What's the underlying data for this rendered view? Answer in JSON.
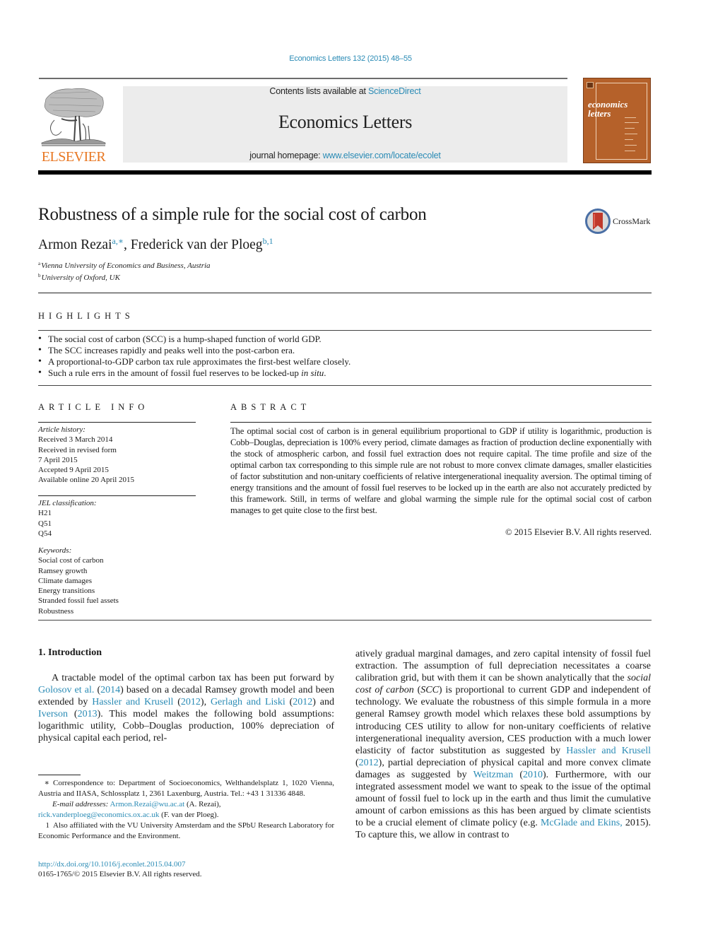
{
  "header": {
    "citation": "Economics Letters 132 (2015) 48–55",
    "contents_prefix": "Contents lists available at ",
    "contents_link": "ScienceDirect",
    "journal_name": "Economics Letters",
    "homepage_prefix": "journal homepage: ",
    "homepage_link": "www.elsevier.com/locate/ecolet",
    "publisher_logo_text": "ELSEVIER",
    "cover_title_line1": "economics",
    "cover_title_line2": "letters",
    "colors": {
      "link": "#2a8bb5",
      "elsevier_orange": "#e87722",
      "cover_brown": "#b5612a",
      "header_box_gray": "#ececec"
    }
  },
  "article": {
    "title": "Robustness of a simple rule for the social cost of carbon",
    "crossmark_label": "CrossMark",
    "authors": [
      {
        "name": "Armon Rezai",
        "marks": "a,∗"
      },
      {
        "name": "Frederick van der Ploeg",
        "marks": "b,1"
      }
    ],
    "author_separator": ", ",
    "affiliations": [
      {
        "mark": "a",
        "text": "Vienna University of Economics and Business, Austria"
      },
      {
        "mark": "b",
        "text": "University of Oxford, UK"
      }
    ]
  },
  "highlights": {
    "heading": "HIGHLIGHTS",
    "items": [
      {
        "text": "The social cost of carbon (SCC) is a hump-shaped function of world GDP.",
        "italic_tail": ""
      },
      {
        "text": "The SCC increases rapidly and peaks well into the post-carbon era.",
        "italic_tail": ""
      },
      {
        "text": "A proportional-to-GDP carbon tax rule approximates the first-best welfare closely.",
        "italic_tail": ""
      },
      {
        "text": "Such a rule errs in the amount of fossil fuel reserves to be locked-up ",
        "italic_tail": "in situ",
        "tail_end": "."
      }
    ]
  },
  "article_info": {
    "heading": "ARTICLE INFO",
    "history_label": "Article history:",
    "history": [
      "Received 3 March 2014",
      "Received in revised form",
      "7 April 2015",
      "Accepted 9 April 2015",
      "Available online 20 April 2015"
    ],
    "jel_label": "JEL classification:",
    "jel": [
      "H21",
      "Q51",
      "Q54"
    ],
    "keywords_label": "Keywords:",
    "keywords": [
      "Social cost of carbon",
      "Ramsey growth",
      "Climate damages",
      "Energy transitions",
      "Stranded fossil fuel assets",
      "Robustness"
    ]
  },
  "abstract": {
    "heading": "ABSTRACT",
    "text": "The optimal social cost of carbon is in general equilibrium proportional to GDP if utility is logarithmic, production is Cobb–Douglas, depreciation is 100% every period, climate damages as fraction of production decline exponentially with the stock of atmospheric carbon, and fossil fuel extraction does not require capital. The time profile and size of the optimal carbon tax corresponding to this simple rule are not robust to more convex climate damages, smaller elasticities of factor substitution and non-unitary coefficients of relative intergenerational inequality aversion. The optimal timing of energy transitions and the amount of fossil fuel reserves to be locked up in the earth are also not accurately predicted by this framework. Still, in terms of welfare and global warming the simple rule for the optimal social cost of carbon manages to get quite close to the first best.",
    "copyright": "© 2015 Elsevier B.V. All rights reserved."
  },
  "introduction": {
    "heading": "1.  Introduction",
    "left_segments": [
      {
        "t": "A tractable model of the optimal carbon tax has been put forward by ",
        "link": false
      },
      {
        "t": "Golosov et al.",
        "link": true
      },
      {
        "t": " (",
        "link": false
      },
      {
        "t": "2014",
        "link": true
      },
      {
        "t": ") based on a decadal Ramsey growth model and been extended by ",
        "link": false
      },
      {
        "t": "Hassler and Krusell",
        "link": true
      },
      {
        "t": " (",
        "link": false
      },
      {
        "t": "2012",
        "link": true
      },
      {
        "t": "), ",
        "link": false
      },
      {
        "t": "Gerlagh and Liski",
        "link": true
      },
      {
        "t": " (",
        "link": false
      },
      {
        "t": "2012",
        "link": true
      },
      {
        "t": ") and ",
        "link": false
      },
      {
        "t": "Iverson",
        "link": true
      },
      {
        "t": " (",
        "link": false
      },
      {
        "t": "2013",
        "link": true
      },
      {
        "t": "). This model makes the following bold assumptions: logarithmic utility, Cobb–Douglas production, 100% depreciation of physical capital each period, rel-",
        "link": false
      }
    ],
    "right_segments": [
      {
        "t": "atively gradual marginal damages, and zero capital intensity of fossil fuel extraction. The assumption of full depreciation necessitates a coarse calibration grid, but with them it can be shown analytically that the ",
        "link": false
      },
      {
        "t": "social cost of carbon",
        "italic": true
      },
      {
        "t": " (",
        "link": false
      },
      {
        "t": "SCC",
        "italic": true
      },
      {
        "t": ") is proportional to current GDP and independent of technology. We evaluate the robustness of this simple formula in a more general Ramsey growth model which relaxes these bold assumptions by introducing CES utility to allow for non-unitary coefficients of relative intergenerational inequality aversion, CES production with a much lower elasticity of factor substitution as suggested by ",
        "link": false
      },
      {
        "t": "Hassler and Krusell",
        "link": true
      },
      {
        "t": " (",
        "link": false
      },
      {
        "t": "2012",
        "link": true
      },
      {
        "t": "), partial depreciation of physical capital and more convex climate damages as suggested by ",
        "link": false
      },
      {
        "t": "Weitzman",
        "link": true
      },
      {
        "t": " (",
        "link": false
      },
      {
        "t": "2010",
        "link": true
      },
      {
        "t": "). Furthermore, with our integrated assessment model we want to speak to the issue of the optimal amount of fossil fuel to lock up in the earth and thus limit the cumulative amount of carbon emissions as this has been argued by climate scientists to be a crucial element of climate policy (e.g. ",
        "link": false
      },
      {
        "t": "McGlade and Ekins,",
        "link": true
      },
      {
        "t": " 2015). To capture this, we allow in contrast to",
        "link": false
      }
    ]
  },
  "footnotes": {
    "star_mark": "∗",
    "correspondence": "Correspondence to: Department of Socioeconomics, Welthandelsplatz 1, 1020 Vienna, Austria and IIASA, Schlossplatz 1, 2361 Laxenburg, Austria. Tel.: +43 1 31336 4848.",
    "email_label": "E-mail addresses:",
    "email1": "Armon.Rezai@wu.ac.at",
    "email1_owner": " (A. Rezai),",
    "email2": "rick.vanderploeg@economics.ox.ac.uk",
    "email2_owner": " (F. van der Ploeg).",
    "one_mark": "1",
    "affiliation_note": "Also affiliated with the VU University Amsterdam and the SPbU Research Laboratory for Economic Performance and the Environment."
  },
  "doi": {
    "url": "http://dx.doi.org/10.1016/j.econlet.2015.04.007",
    "issn_line": "0165-1765/© 2015 Elsevier B.V. All rights reserved."
  }
}
